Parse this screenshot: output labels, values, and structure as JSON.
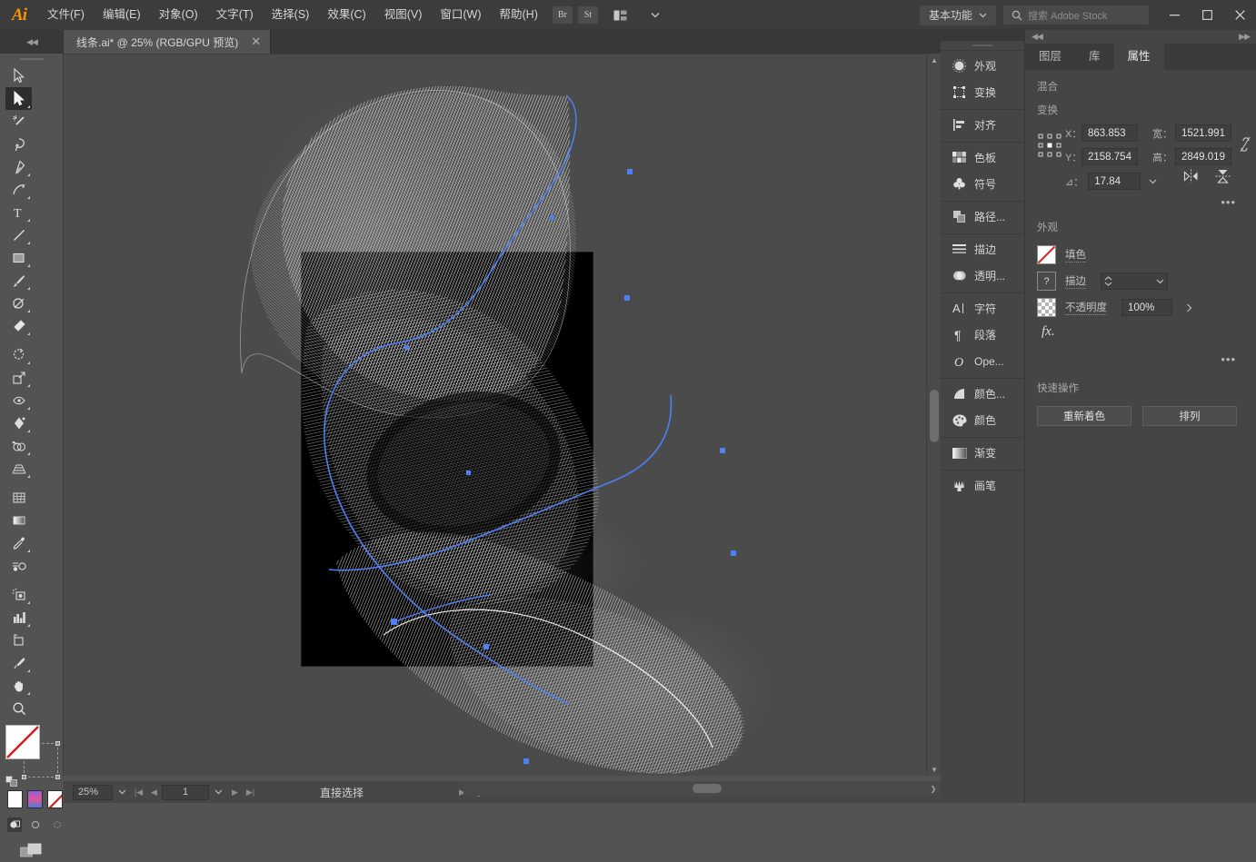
{
  "app": {
    "name": "Adobe Illustrator",
    "logo": "Ai"
  },
  "menubar": {
    "items": [
      {
        "label": "文件(F)",
        "name": "menu-file"
      },
      {
        "label": "编辑(E)",
        "name": "menu-edit"
      },
      {
        "label": "对象(O)",
        "name": "menu-object"
      },
      {
        "label": "文字(T)",
        "name": "menu-type"
      },
      {
        "label": "选择(S)",
        "name": "menu-select"
      },
      {
        "label": "效果(C)",
        "name": "menu-effect"
      },
      {
        "label": "视图(V)",
        "name": "menu-view"
      },
      {
        "label": "窗口(W)",
        "name": "menu-window"
      },
      {
        "label": "帮助(H)",
        "name": "menu-help"
      }
    ],
    "bridge_label": "Br",
    "stock_label": "St",
    "workspace": "基本功能",
    "search_placeholder": "搜索 Adobe Stock",
    "window_controls": {
      "minimize": "—",
      "maximize": "▢",
      "close": "✕"
    }
  },
  "tabbar": {
    "document_title": "线条.ai* @ 25% (RGB/GPU 预览)",
    "close_label": "✕"
  },
  "statusbar": {
    "zoom": "25%",
    "page": "1",
    "tool_status": "直接选择"
  },
  "toolbar": {
    "tools": [
      {
        "name": "selection-tool",
        "label": "选择工具"
      },
      {
        "name": "direct-selection-tool",
        "label": "直接选择工具",
        "active": true
      },
      {
        "name": "magic-wand-tool",
        "label": "魔棒工具"
      },
      {
        "name": "lasso-tool",
        "label": "套索工具"
      },
      {
        "name": "pen-tool",
        "label": "钢笔工具"
      },
      {
        "name": "curvature-tool",
        "label": "曲率工具"
      },
      {
        "name": "type-tool",
        "label": "文字工具"
      },
      {
        "name": "line-segment-tool",
        "label": "直线段工具"
      },
      {
        "name": "rectangle-tool",
        "label": "矩形工具"
      },
      {
        "name": "paintbrush-tool",
        "label": "画笔工具"
      },
      {
        "name": "shaper-tool",
        "label": "Shaper 工具"
      },
      {
        "name": "eraser-tool",
        "label": "橡皮擦工具"
      },
      {
        "name": "rotate-tool",
        "label": "旋转工具"
      },
      {
        "name": "scale-tool",
        "label": "比例缩放工具"
      },
      {
        "name": "width-tool",
        "label": "宽度工具"
      },
      {
        "name": "free-transform-tool",
        "label": "自由变换工具"
      },
      {
        "name": "shape-builder-tool",
        "label": "形状生成器工具"
      },
      {
        "name": "perspective-grid-tool",
        "label": "透视网格工具"
      },
      {
        "name": "mesh-tool",
        "label": "网格工具"
      },
      {
        "name": "gradient-tool",
        "label": "渐变工具"
      },
      {
        "name": "eyedropper-tool",
        "label": "吸管工具"
      },
      {
        "name": "blend-tool",
        "label": "混合工具"
      },
      {
        "name": "symbol-sprayer-tool",
        "label": "符号喷枪工具"
      },
      {
        "name": "column-graph-tool",
        "label": "柱形图工具"
      },
      {
        "name": "artboard-tool",
        "label": "画板工具"
      },
      {
        "name": "slice-tool",
        "label": "切片工具"
      },
      {
        "name": "hand-tool",
        "label": "抓手工具"
      },
      {
        "name": "zoom-tool",
        "label": "缩放工具"
      }
    ],
    "fill_state": "none",
    "stroke_state": "none",
    "swatches": [
      {
        "name": "swatch-white-fill",
        "label": "颜色"
      },
      {
        "name": "swatch-gradient",
        "label": "渐变"
      },
      {
        "name": "swatch-none",
        "label": "无"
      }
    ],
    "draw_modes": [
      {
        "name": "draw-normal-mode",
        "label": "正常绘图",
        "active": true
      },
      {
        "name": "draw-behind-mode",
        "label": "背面绘图"
      },
      {
        "name": "draw-inside-mode",
        "label": "内部绘图"
      }
    ],
    "screen_mode": "更改屏幕模式"
  },
  "icondock": {
    "groups": [
      [
        {
          "label": "外观",
          "icon": "appearance-icon"
        },
        {
          "label": "变换",
          "icon": "transform-icon"
        }
      ],
      [
        {
          "label": "对齐",
          "icon": "align-icon"
        }
      ],
      [
        {
          "label": "色板",
          "icon": "swatches-icon"
        },
        {
          "label": "符号",
          "icon": "symbols-icon"
        }
      ],
      [
        {
          "label": "路径...",
          "icon": "pathfinder-icon"
        }
      ],
      [
        {
          "label": "描边",
          "icon": "stroke-icon"
        },
        {
          "label": "透明...",
          "icon": "transparency-icon"
        }
      ],
      [
        {
          "label": "字符",
          "icon": "character-icon"
        },
        {
          "label": "段落",
          "icon": "paragraph-icon"
        },
        {
          "label": "Ope...",
          "icon": "opentype-icon"
        }
      ],
      [
        {
          "label": "颜色...",
          "icon": "color-guide-icon"
        },
        {
          "label": "颜色",
          "icon": "color-icon"
        }
      ],
      [
        {
          "label": "渐变",
          "icon": "gradient-icon"
        }
      ],
      [
        {
          "label": "画笔",
          "icon": "brushes-icon"
        }
      ]
    ]
  },
  "properties": {
    "tabs": [
      {
        "label": "图层",
        "name": "tab-layers",
        "active": false
      },
      {
        "label": "库",
        "name": "tab-libraries",
        "active": false
      },
      {
        "label": "属性",
        "name": "tab-properties",
        "active": true
      }
    ],
    "selection_label": "混合",
    "transform": {
      "section_label": "变换",
      "x_label": "X：",
      "x_value": "863.853",
      "y_label": "Y：",
      "y_value": "2158.754",
      "w_label": "宽：",
      "w_value": "1521.991",
      "h_label": "高：",
      "h_value": "2849.019",
      "angle_label": "⊿：",
      "angle_value": "17.84",
      "flip_h": "水平翻转",
      "flip_v": "垂直翻转",
      "more": "•••"
    },
    "appearance": {
      "section_label": "外观",
      "fill_label": "填色",
      "stroke_label": "描边",
      "stroke_weight": "",
      "opacity_label": "不透明度",
      "opacity_value": "100%",
      "fx_label": "fx.",
      "more": "•••"
    },
    "quick_actions": {
      "section_label": "快速操作",
      "buttons": [
        {
          "label": "重新着色",
          "name": "recolor-button"
        },
        {
          "label": "排列",
          "name": "arrange-button"
        }
      ]
    }
  },
  "canvas": {
    "artboard_bg": "#000000",
    "canvas_bg": "#4b4b4b",
    "path_color": "#4d7ff5",
    "artwork_color": "#ffffff",
    "description": "白色线条螺旋丝带图形"
  },
  "colors": {
    "chrome": "#535353",
    "panel": "#454545",
    "menubar": "#3c3c3c",
    "accent_orange": "#f79500",
    "selection_blue": "#4d7ff5"
  }
}
